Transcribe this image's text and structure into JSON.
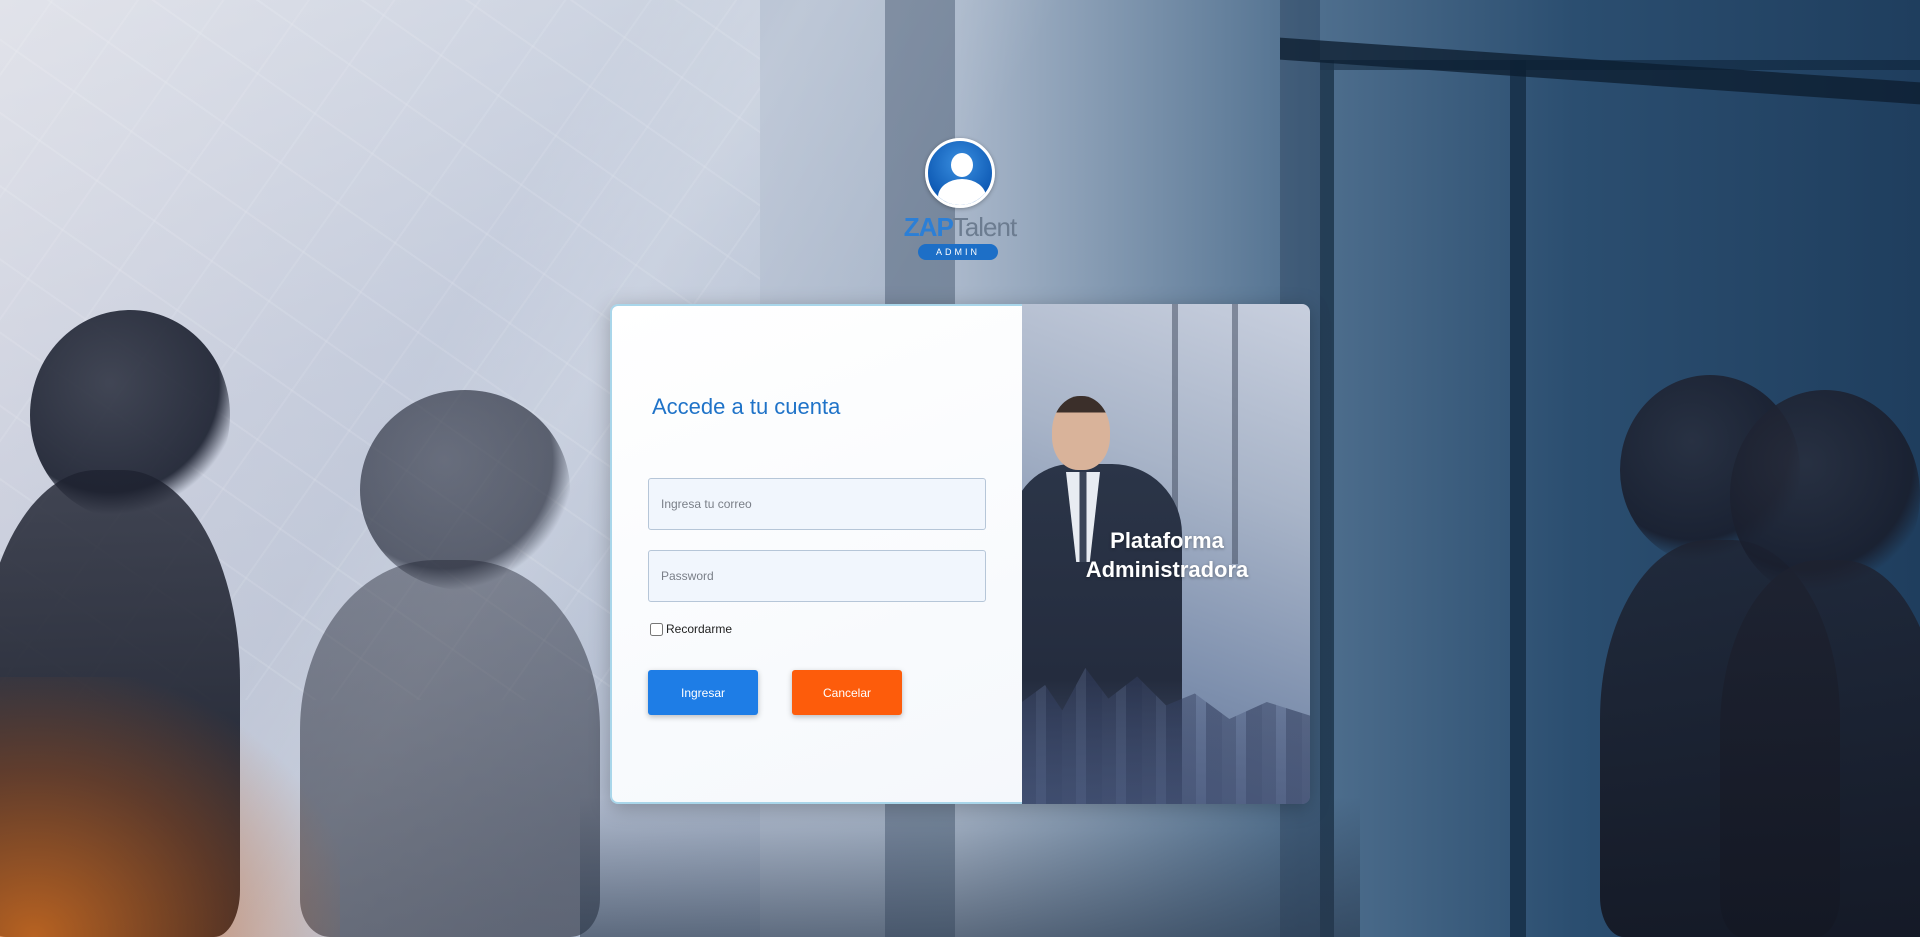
{
  "logo": {
    "brand_prefix": "ZAP",
    "brand_suffix": "Talent",
    "badge": "ADMIN"
  },
  "login": {
    "title": "Accede a tu cuenta",
    "email_placeholder": "Ingresa tu correo",
    "password_placeholder": "Password",
    "remember_label": "Recordarme",
    "submit_label": "Ingresar",
    "cancel_label": "Cancelar"
  },
  "promo": {
    "title_line1": "Plataforma",
    "title_line2": "Administradora"
  },
  "colors": {
    "primary": "#1e7de6",
    "cancel": "#fd5c0b",
    "title": "#1f73c8"
  }
}
